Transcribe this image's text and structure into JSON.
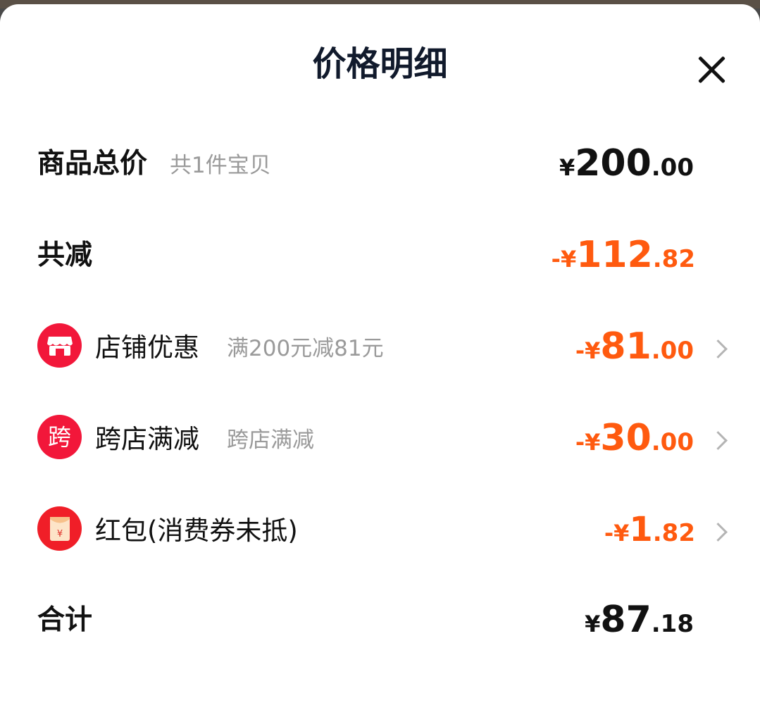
{
  "title": "价格明细",
  "goods_total": {
    "label": "商品总价",
    "sub": "共1件宝贝",
    "currency": "¥",
    "int": "200",
    "dec": ".00"
  },
  "total_reduce": {
    "label": "共减",
    "sign": "-",
    "currency": "¥",
    "int": "112",
    "dec": ".82"
  },
  "discounts": [
    {
      "icon": "store-icon",
      "label": "店铺优惠",
      "sub": "满200元减81元",
      "sign": "-",
      "currency": "¥",
      "int": "81",
      "dec": ".00"
    },
    {
      "icon_text": "跨",
      "icon": "cross-store-icon",
      "label": "跨店满减",
      "sub": "跨店满减",
      "sign": "-",
      "currency": "¥",
      "int": "30",
      "dec": ".00"
    },
    {
      "icon": "red-packet-icon",
      "label": "红包(消费券未抵)",
      "sub": "",
      "sign": "-",
      "currency": "¥",
      "int": "1",
      "dec": ".82"
    }
  ],
  "grand_total": {
    "label": "合计",
    "currency": "¥",
    "int": "87",
    "dec": ".18"
  },
  "colors": {
    "accent": "#ff5a0f",
    "badge": "#f2173a",
    "text": "#111111",
    "muted": "#9a9a9a"
  }
}
